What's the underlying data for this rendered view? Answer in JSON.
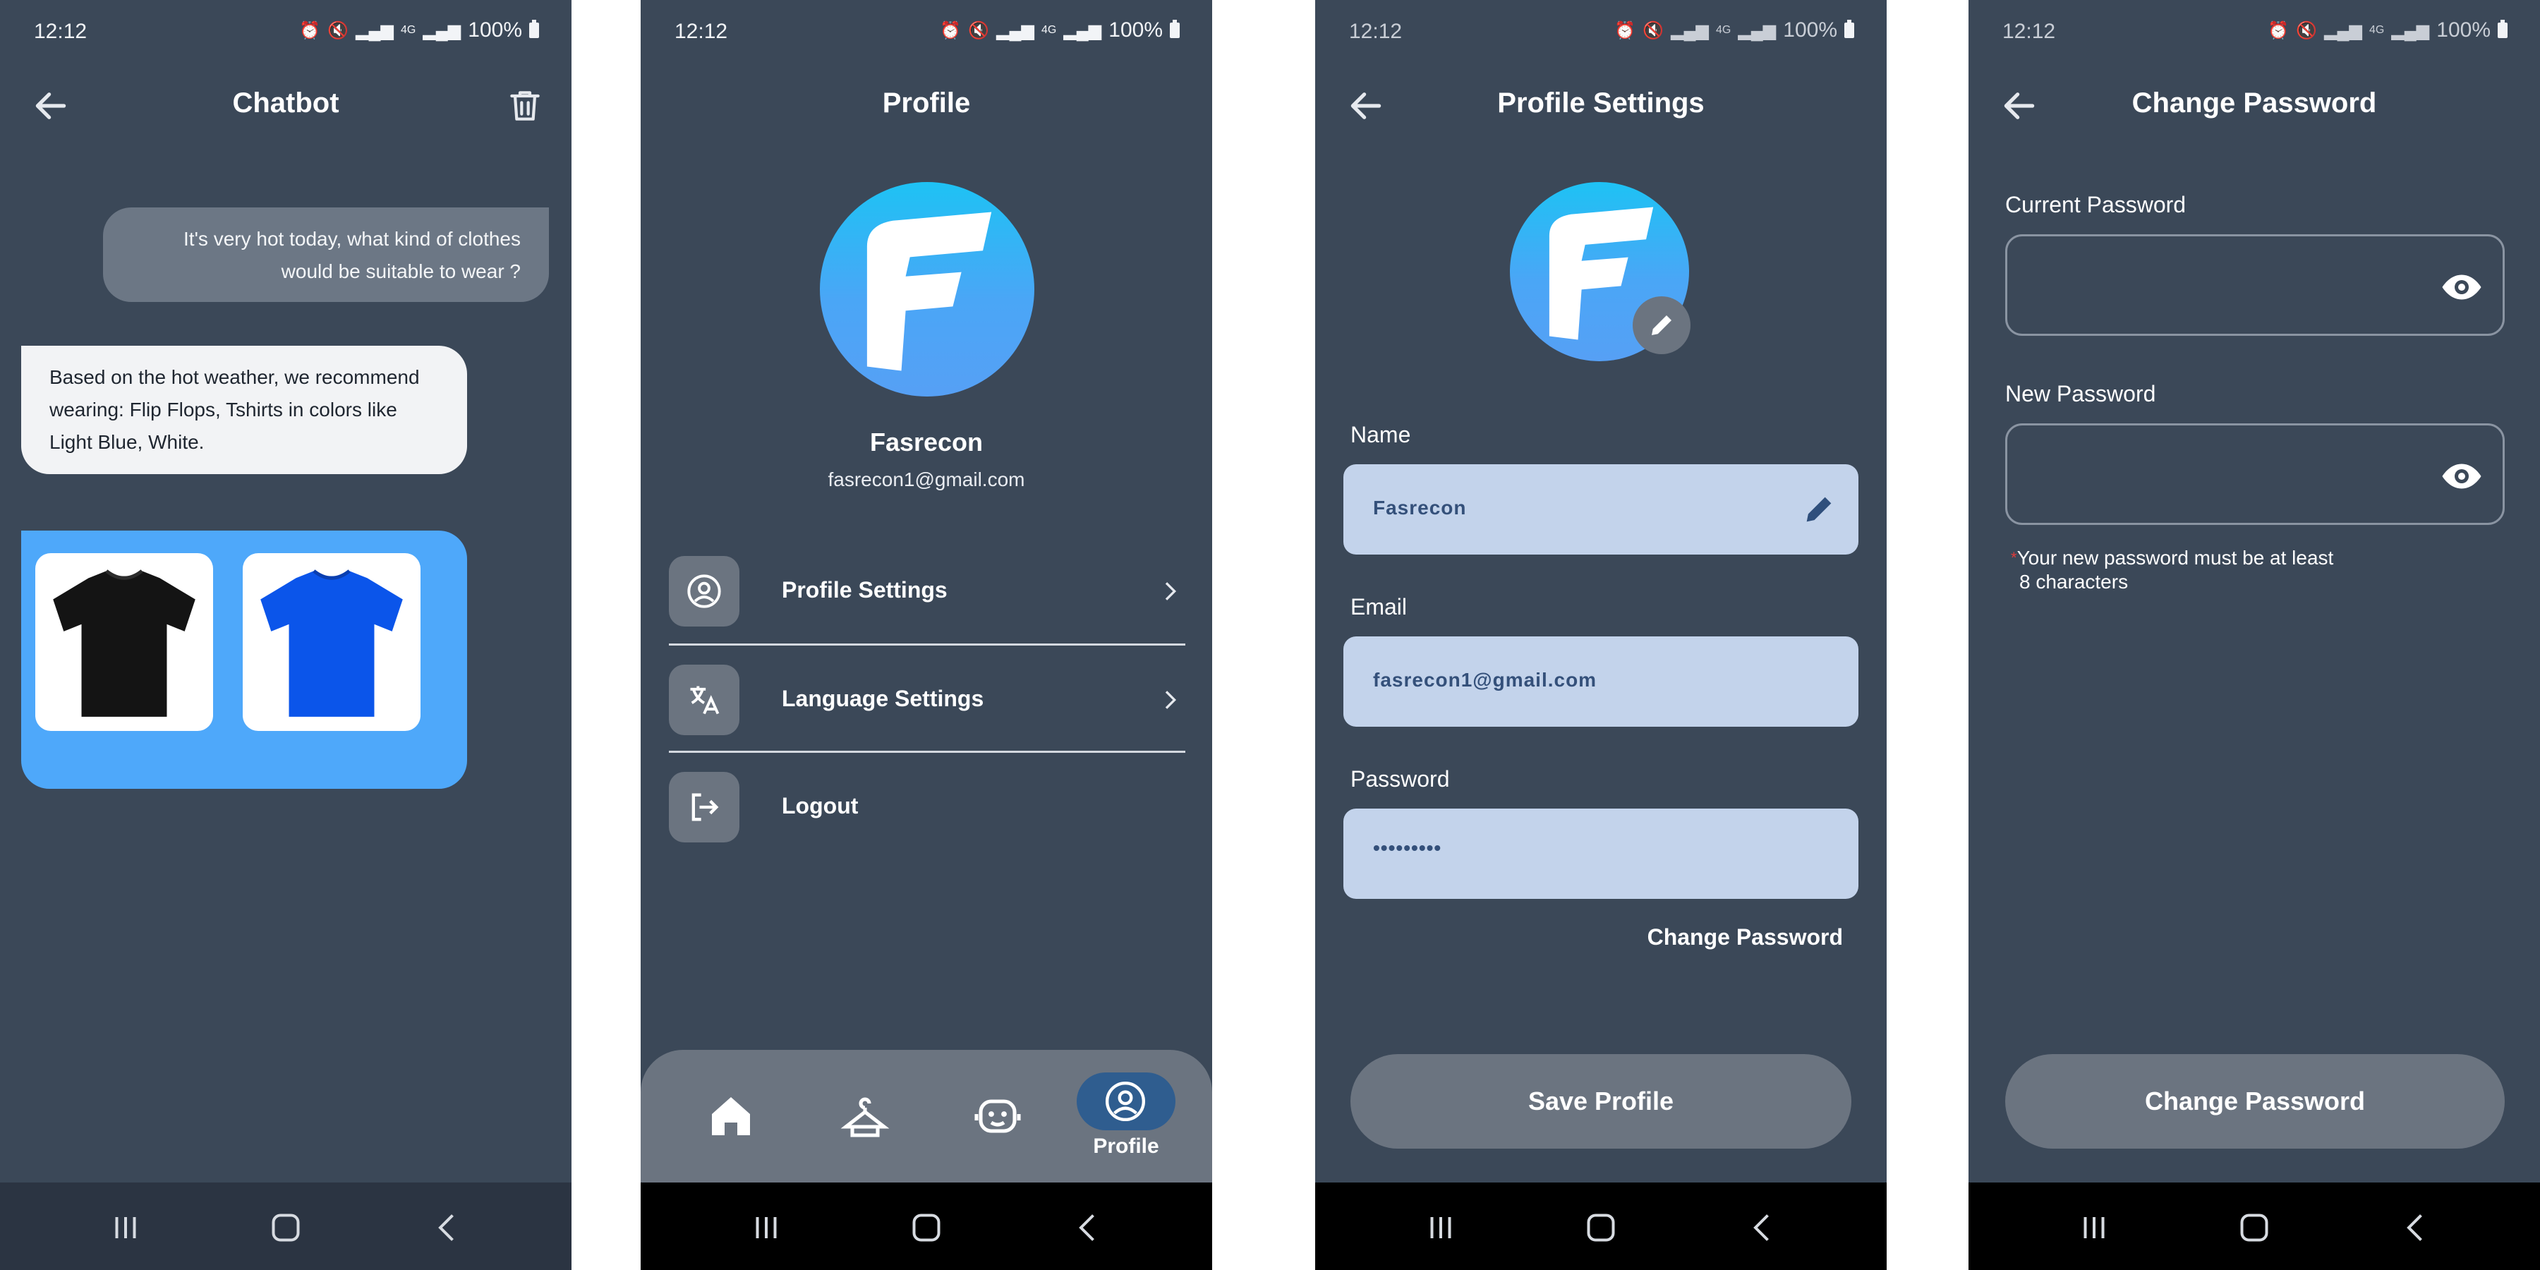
{
  "status_bar": {
    "time": "12:12",
    "battery": "100%",
    "signal_tag": "4G"
  },
  "chatbot": {
    "title": "Chatbot",
    "back_icon": "arrow-left-icon",
    "delete_icon": "trash-icon",
    "user_message": "It's very hot today, what kind of clothes would be suitable to wear ?",
    "bot_message": "Based on the hot weather, we recommend wearing: Flip Flops, Tshirts in colors like Light Blue, White.",
    "suggestions": [
      {
        "item": "black-tshirt",
        "color": "#141414"
      },
      {
        "item": "blue-tshirt",
        "color": "#0b55ea"
      }
    ]
  },
  "profile": {
    "title": "Profile",
    "name": "Fasrecon",
    "email": "fasrecon1@gmail.com",
    "menu": [
      {
        "label": "Profile Settings",
        "icon": "user-circle-icon",
        "chevron": true
      },
      {
        "label": "Language Settings",
        "icon": "translate-icon",
        "chevron": true
      },
      {
        "label": "Logout",
        "icon": "logout-icon",
        "chevron": false
      }
    ],
    "tabs": [
      {
        "name": "home",
        "icon": "home-icon",
        "active": false
      },
      {
        "name": "wardrobe",
        "icon": "hanger-icon",
        "active": false
      },
      {
        "name": "chatbot",
        "icon": "bot-face-icon",
        "active": false
      },
      {
        "name": "profile",
        "icon": "user-circle-icon",
        "active": true,
        "label": "Profile"
      }
    ]
  },
  "profile_settings": {
    "title": "Profile Settings",
    "name_label": "Name",
    "name_value": "Fasrecon",
    "email_label": "Email",
    "email_value": "fasrecon1@gmail.com",
    "password_label": "Password",
    "password_value": "•••••••••",
    "change_password_link": "Change Password",
    "save_button": "Save Profile"
  },
  "change_password": {
    "title": "Change Password",
    "current_label": "Current Password",
    "new_label": "New Password",
    "hint_line1": "Your new password must be at least",
    "hint_line2": "8 characters",
    "button": "Change Password"
  },
  "colors": {
    "background": "#3b4858",
    "accent_blue": "#4ea8fa",
    "field_fill": "#c3d3eb",
    "button_grey": "#6b7480",
    "active_tab": "#2f5d8f",
    "required_star": "#e23b3b"
  }
}
